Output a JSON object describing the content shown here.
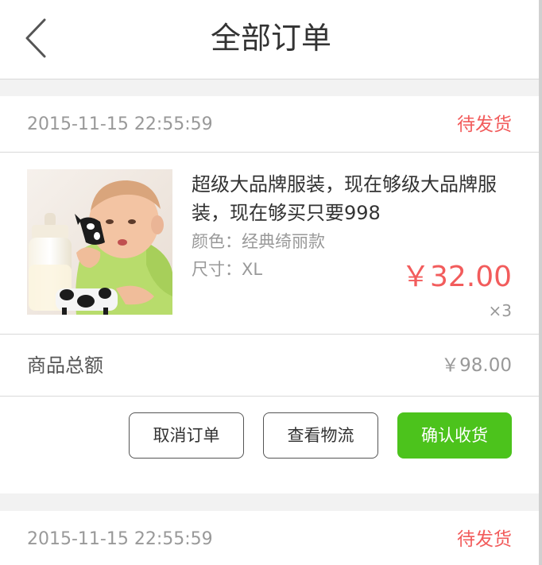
{
  "header": {
    "title": "全部订单",
    "back_icon": "chevron-left-icon"
  },
  "orders": [
    {
      "time": "2015-11-15 22:55:59",
      "status": "待发货",
      "product": {
        "name": "超级大品牌服装，现在够级大品牌服装，现在够买只要998",
        "color": "颜色：经典绮丽款",
        "size": "尺寸：XL",
        "price": "￥32.00",
        "quantity": "×3"
      },
      "total_label": "商品总额",
      "total_value": "￥98.00",
      "buttons": {
        "cancel": "取消订单",
        "logistics": "查看物流",
        "confirm": "确认收货"
      }
    },
    {
      "time": "2015-11-15 22:55:59",
      "status": "待发货"
    }
  ],
  "colors": {
    "status": "#f25c5c",
    "price": "#f25c5c",
    "confirm_button": "#4cc31c",
    "muted_text": "#999999",
    "background": "#f2f2f2"
  }
}
